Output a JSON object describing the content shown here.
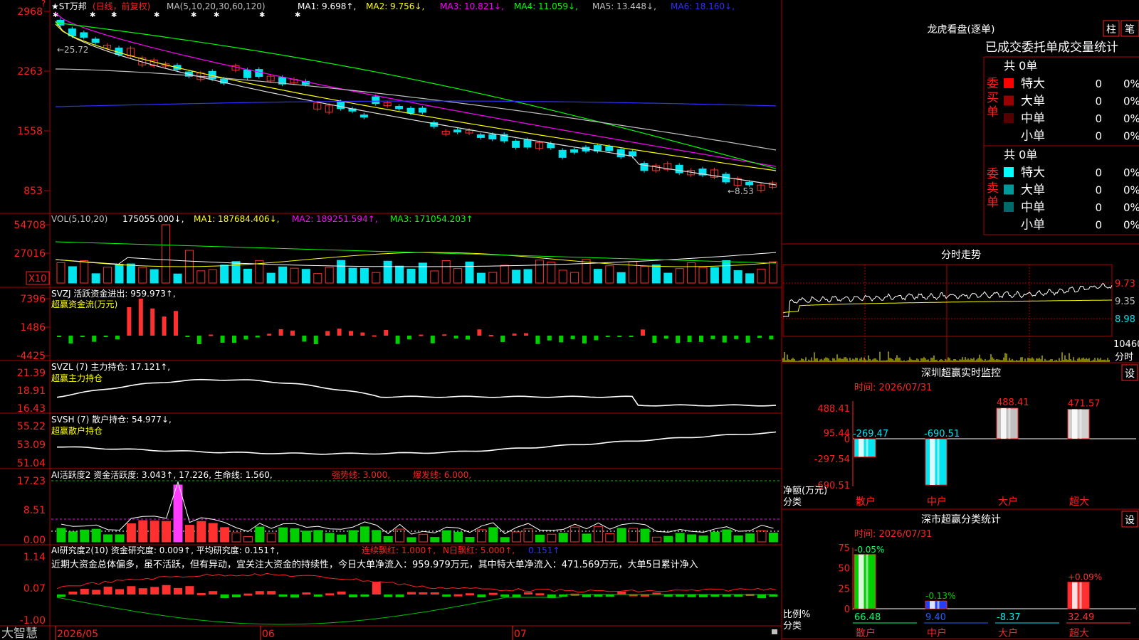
{
  "colors": {
    "red": "#ff2020",
    "up": "#ff3030",
    "down": "#00e5ee",
    "yellow": "#ffff00",
    "magenta": "#ff00ff",
    "green": "#00d000",
    "blue": "#1c1cff",
    "white": "#e0e0e0",
    "gray": "#c0c0c0",
    "pink": "#ff3cff",
    "gridred": "#b00000"
  },
  "main": {
    "stock": "★ST万邦",
    "period_note": "(日线，前复权)",
    "ma_label": "MA(5,10,20,30,60,120)",
    "ma": [
      {
        "label": "MA1: 9.698↑",
        "color": "#ffffff"
      },
      {
        "label": "MA2: 9.756↓",
        "color": "#ffff00"
      },
      {
        "label": "MA3: 10.821↓",
        "color": "#ff00ff"
      },
      {
        "label": "MA4: 11.059↓",
        "color": "#00ff00"
      },
      {
        "label": "MA5: 13.448↓",
        "color": "#c0c0c0"
      },
      {
        "label": "MA6: 18.160↓",
        "color": "#3030ff"
      }
    ],
    "y_ticks": [
      "2968",
      "2263",
      "1558",
      "853"
    ],
    "high_note": "←25.72",
    "low_note": "←8.53"
  },
  "vol": {
    "title": "VOL(5,10,20)",
    "value": "175055.000↓,",
    "ma1": "MA1: 187684.406↓,",
    "ma2": "MA2: 189251.594↑,",
    "ma3": "MA3: 171054.203↑",
    "y_ticks": [
      "54708",
      "27016"
    ],
    "unit": "X10"
  },
  "svzj": {
    "title": "SVZJ  活跃资金进出: 959.973↑,",
    "sub": "超赢资金流(万元)",
    "y_ticks": [
      "7396",
      "1486",
      "-4425"
    ]
  },
  "svzl": {
    "title": "SVZL (7) 主力持仓: 17.121↑,",
    "sub": "超赢主力持仓",
    "y_ticks": [
      "21.39",
      "18.91",
      "16.43"
    ]
  },
  "svsh": {
    "title": "SVSH (7) 散户持仓: 54.977↓,",
    "sub": "超赢散户持仓",
    "y_ticks": [
      "55.22",
      "53.09",
      "51.04"
    ]
  },
  "ai1": {
    "title": "AI活跃度2 资金活跃度: 3.043↑, 17.226, 生命线: 1.560,",
    "strong": "强势线: 3.000,",
    "burst": "爆发线: 6.000,",
    "y_ticks": [
      "17.23",
      "8.51",
      "0.00"
    ]
  },
  "ai2": {
    "title": "AI研究度2(10) 资金研究度: 0.009↑, 平均研究度: 0.151↑,",
    "red1": "连续飘红: 1.000↑,",
    "red2": "N日飘红: 5.000↑,",
    "blue": "0.151↑",
    "comment": "近期大资金总体偏多，虽不活跃，但有异动，宜关注大资金的持续性，今日大单净流入：959.979万元，其中特大单净流入：471.569万元，大单5日累计净入",
    "y_ticks": [
      "1.14",
      "0.07",
      "-1.00"
    ]
  },
  "bottom": {
    "logo": "大智慧",
    "dates": [
      "2026/05",
      "06",
      "07"
    ]
  },
  "dragon": {
    "title": "龙虎看盘(逐单)",
    "btn1": "柱",
    "btn2": "笔",
    "header": "已成交委托单成交量统计",
    "buy_label": "委买单",
    "sell_label": "委卖单",
    "buy_total": "共 0单",
    "sell_total": "共 0单",
    "buy_rows": [
      {
        "name": "特大",
        "count": "0",
        "pct": "0%",
        "color": "#ff0000"
      },
      {
        "name": "大单",
        "count": "0",
        "pct": "0%",
        "color": "#990000"
      },
      {
        "name": "中单",
        "count": "0",
        "pct": "0%",
        "color": "#550000"
      },
      {
        "name": "小单",
        "count": "0",
        "pct": "0%",
        "color": ""
      }
    ],
    "sell_rows": [
      {
        "name": "特大",
        "count": "0",
        "pct": "0%",
        "color": "#00ffff"
      },
      {
        "name": "大单",
        "count": "0",
        "pct": "0%",
        "color": "#009a9a"
      },
      {
        "name": "中单",
        "count": "0",
        "pct": "0%",
        "color": "#006a6a"
      },
      {
        "name": "小单",
        "count": "0",
        "pct": "0%",
        "color": ""
      }
    ]
  },
  "intraday": {
    "title": "分时走势",
    "y_ticks": [
      "9.73",
      "9.35",
      "8.98"
    ],
    "vol_label": "10460",
    "vol_unit": "分时"
  },
  "monitor": {
    "title": "深圳超赢实时监控",
    "set": "设",
    "time": "时间: 2026/07/31",
    "y_ticks": [
      "488.41",
      "95.44",
      "0",
      "-297.54",
      "-690.51"
    ],
    "axis_label1": "净额(万元)",
    "axis_label2": "分类",
    "categories": [
      "散户",
      "中户",
      "大户",
      "超大"
    ],
    "values": [
      -269.47,
      -690.51,
      488.41,
      471.57
    ],
    "value_labels": [
      "-269.47",
      "-690.51",
      "488.41",
      "471.57"
    ]
  },
  "stats": {
    "title": "深市超赢分类统计",
    "set": "设",
    "time": "时间: 2026/07/31",
    "y_ticks": [
      "75",
      "50",
      "25",
      "0"
    ],
    "axis_label1": "比例%",
    "axis_label2": "分类",
    "categories": [
      "散户",
      "中户",
      "大户",
      "超大"
    ],
    "values": [
      66.48,
      9.4,
      -8.37,
      32.49
    ],
    "value_labels": [
      "66.48",
      "9.40",
      "-8.37",
      "32.49"
    ],
    "change_labels": [
      "-0.05%",
      "-0.13%",
      "",
      "+0.09%"
    ]
  }
}
